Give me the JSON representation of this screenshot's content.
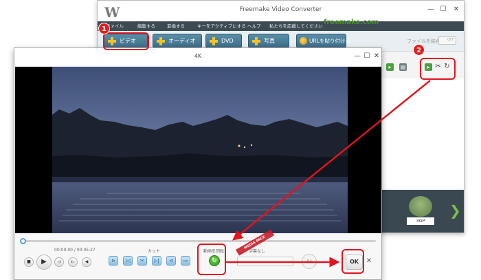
{
  "background_window": {
    "logo_glyph": "W",
    "title": "Freemake Video Converter",
    "window_controls": [
      "—",
      "☐",
      "✕"
    ],
    "menu": [
      "ファイル",
      "編集する",
      "変換する",
      "キーをアクティブにする",
      "ヘルプ",
      "私たちを応援してください"
    ],
    "brand": "freemake.com",
    "toolbar_buttons": [
      "ビデオ",
      "オーディオ",
      "DVD",
      "写真"
    ],
    "url_button": "URLを貼り付ける",
    "merge_label": "ファイルを結合",
    "merge_toggle": "OFF",
    "format_tile": {
      "label": "3GP"
    },
    "next_arrow": "❯"
  },
  "foreground_window": {
    "title": "4K",
    "window_controls": [
      "—",
      "☐",
      "✕"
    ],
    "time": "00:00:00 / 00:05:27",
    "cut_label": "カット",
    "rotate_label": "動画を回転",
    "subtitle_label": "字幕なし",
    "subtitle_round": "Aa",
    "ok_label": "OK",
    "close_glyph": "✕",
    "playback_glyphs": {
      "stop": "■",
      "play": "▶",
      "prev": "◁I",
      "next": "I▷",
      "step_back": "◀"
    },
    "cut_glyphs": [
      "⊳",
      "|◁",
      "✂",
      "▷|",
      "⊲",
      "▭"
    ]
  },
  "annotations": {
    "step1": "1",
    "step2": "2",
    "watermark": "MEDIA PACK"
  },
  "colors": {
    "highlight": "#e0141e",
    "arrow": "#e0141e",
    "toolbar_button": "#3e6d87",
    "menubar": "#3d4a52",
    "brand_green": "#4a8f2a"
  }
}
